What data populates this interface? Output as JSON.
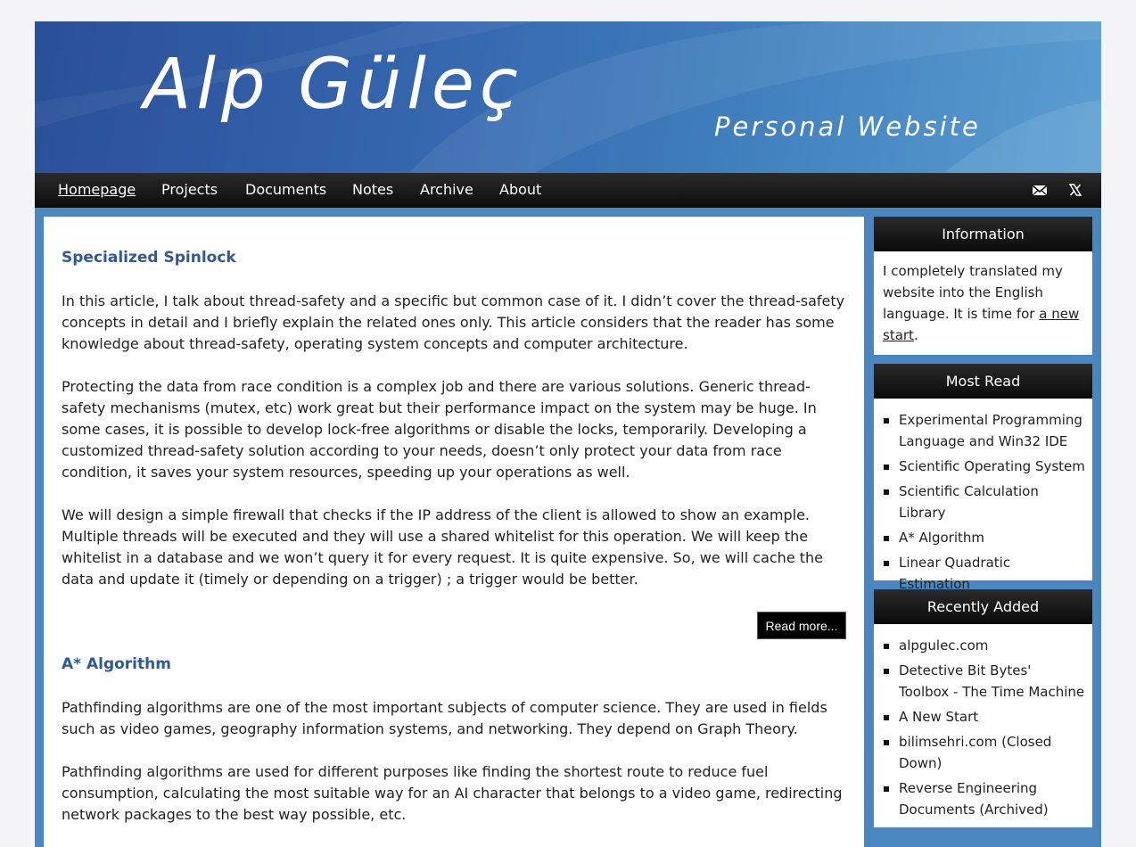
{
  "header": {
    "title": "Alp Güleç",
    "subtitle": "Personal Website"
  },
  "nav": {
    "items": [
      {
        "label": "Homepage",
        "active": true
      },
      {
        "label": "Projects"
      },
      {
        "label": "Documents"
      },
      {
        "label": "Notes"
      },
      {
        "label": "Archive"
      },
      {
        "label": "About"
      }
    ],
    "icons": [
      "mail-icon",
      "x-twitter-icon"
    ]
  },
  "posts": [
    {
      "title": "Specialized Spinlock",
      "paragraphs": [
        "In this article, I talk about thread-safety and a specific but common case of it. I didn’t cover the thread-safety concepts in detail and I briefly explain the related ones only. This article considers that the reader has some knowledge about thread-safety, operating system concepts and computer architecture.",
        "Protecting the data from race condition is a complex job and there are various solutions. Generic thread-safety mechanisms (mutex, etc) work great but their performance impact on the system may be huge. In some cases, it is possible to develop lock-free algorithms or disable the locks, temporarily. Developing a customized thread-safety solution according to your needs, doesn’t only protect your data from race condition, it saves your system resources, speeding up your operations as well.",
        "We will design a simple firewall that checks if the IP address of the client is allowed to show an example. Multiple threads will be executed and they will use a shared whitelist for this operation. We will keep the whitelist in a database and we won’t query it for every request. It is quite expensive. So, we will cache the data and update it (timely or depending on a trigger) ; a trigger would be better."
      ],
      "read_more": "Read more..."
    },
    {
      "title": "A* Algorithm",
      "paragraphs": [
        "Pathfinding algorithms are one of the most important subjects of computer science. They are used in fields such as video games, geography information systems, and networking. They depend on Graph Theory.",
        "Pathfinding algorithms are used for different purposes like finding the shortest route to reduce fuel consumption, calculating the most suitable way for an AI character that belongs to a video game, redirecting network packages to the best way possible, etc."
      ]
    }
  ],
  "sidebar": {
    "information": {
      "title": "Information",
      "text_before": "I completely translated my website into the English language. It is time for ",
      "link": "a new start",
      "text_after": "."
    },
    "most_read": {
      "title": "Most Read",
      "items": [
        "Experimental Programming Language and Win32 IDE",
        "Scientific Operating System",
        "Scientific Calculation Library",
        "A* Algorithm",
        "Linear Quadratic Estimation"
      ]
    },
    "recently_added": {
      "title": "Recently Added",
      "items": [
        "alpgulec.com",
        "Detective Bit Bytes' Toolbox - The Time Machine",
        "A New Start",
        "bilimsehri.com (Closed Down)",
        "Reverse Engineering Documents (Archived)"
      ]
    }
  }
}
